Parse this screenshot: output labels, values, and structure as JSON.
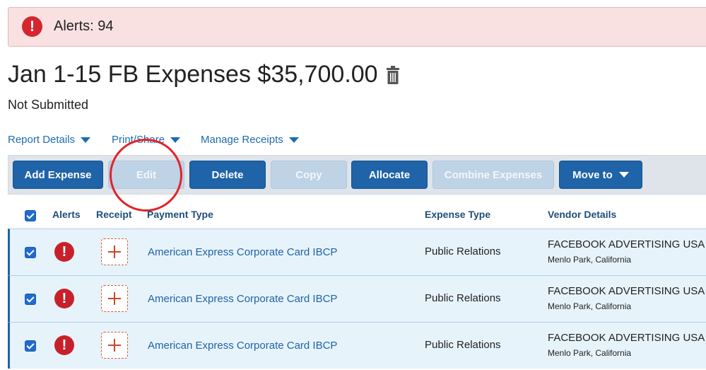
{
  "alert": {
    "text": "Alerts: 94",
    "icon": "exclamation-icon"
  },
  "report": {
    "title": "Jan 1-15 FB Expenses $35,700.00",
    "status": "Not Submitted"
  },
  "menus": [
    "Report Details",
    "Print/Share",
    "Manage Receipts"
  ],
  "toolbar": {
    "add_expense": "Add Expense",
    "edit": "Edit",
    "delete": "Delete",
    "copy": "Copy",
    "allocate": "Allocate",
    "combine": "Combine Expenses",
    "move_to": "Move to"
  },
  "table": {
    "headers": [
      "Alerts",
      "Receipt",
      "Payment Type",
      "Expense Type",
      "Vendor Details"
    ],
    "rows": [
      {
        "payment": "American Express Corporate Card IBCP",
        "expense_type": "Public Relations",
        "vendor": "FACEBOOK ADVERTISING USA",
        "location": "Menlo Park, California"
      },
      {
        "payment": "American Express Corporate Card IBCP",
        "expense_type": "Public Relations",
        "vendor": "FACEBOOK ADVERTISING USA",
        "location": "Menlo Park, California"
      },
      {
        "payment": "American Express Corporate Card IBCP",
        "expense_type": "Public Relations",
        "vendor": "FACEBOOK ADVERTISING USA",
        "location": "Menlo Park, California"
      }
    ]
  },
  "colors": {
    "primary": "#1f63a8",
    "alert_red": "#d4262e",
    "row_bg": "#e7f3fb",
    "annotation": "#e0242a"
  }
}
